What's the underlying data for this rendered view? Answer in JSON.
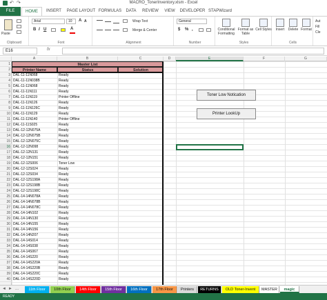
{
  "window": {
    "title": "MACRO_TonerInventory.xlsm - Excel"
  },
  "ribbon_tabs": [
    "FILE",
    "HOME",
    "INSERT",
    "PAGE LAYOUT",
    "FORMULAS",
    "DATA",
    "REVIEW",
    "VIEW",
    "DEVELOPER",
    "STAPWizard"
  ],
  "active_tab": "HOME",
  "ribbon": {
    "clipboard": {
      "paste": "Paste",
      "label": "Clipboard"
    },
    "font": {
      "name": "Arial",
      "size": "10",
      "bold": "B",
      "italic": "I",
      "underline": "U",
      "label": "Font"
    },
    "alignment": {
      "wrap_text": "Wrap Text",
      "merge_center": "Merge & Center",
      "label": "Alignment"
    },
    "number": {
      "format": "General",
      "currency": "$",
      "percent": "%",
      "comma": ",",
      "label": "Number"
    },
    "styles": {
      "conditional": "Conditional Formatting",
      "format_table": "Format as Table",
      "cell_styles": "Cell Styles",
      "label": "Styles"
    },
    "cells": {
      "insert": "Insert",
      "delete": "Delete",
      "format": "Format",
      "label": "Cells"
    },
    "editing": {
      "autosum": "Aut",
      "fill": "Fill",
      "clear": "Cle"
    }
  },
  "formula_bar": {
    "name_box": "E16",
    "fx": "fx",
    "value": ""
  },
  "columns": [
    "A",
    "B",
    "C",
    "D",
    "E",
    "F",
    "G"
  ],
  "selected_column": "E",
  "selected_row": "16",
  "rows": [
    "1",
    "2",
    "3",
    "4",
    "5",
    "6",
    "7",
    "8",
    "9",
    "10",
    "11",
    "12",
    "13",
    "14",
    "15",
    "16",
    "17",
    "18",
    "19",
    "20",
    "21",
    "22",
    "23",
    "24",
    "25",
    "26",
    "27",
    "28",
    "29",
    "30",
    "31",
    "32",
    "33",
    "34",
    "35",
    "36",
    "37",
    "38",
    "39",
    "40"
  ],
  "master_list": {
    "title": "Master List",
    "headers": [
      "Printer Name",
      "Status",
      "Solution"
    ],
    "entries": [
      {
        "name": "DAL-11-11N068",
        "status": "Ready"
      },
      {
        "name": "DAL-11-11N038B",
        "status": "Ready"
      },
      {
        "name": "DAL-11-11N068",
        "status": "Ready"
      },
      {
        "name": "DAL-11-11N111",
        "status": "Ready"
      },
      {
        "name": "DAL-11-11N119",
        "status": "Printer Offline"
      },
      {
        "name": "DAL-11-11N126",
        "status": "Ready"
      },
      {
        "name": "DAL-11-11N126C",
        "status": "Ready"
      },
      {
        "name": "DAL-11-11N129",
        "status": "Ready"
      },
      {
        "name": "DAL-11-11N140",
        "status": "Printer Offline"
      },
      {
        "name": "DAL-11-11S025",
        "status": "Ready"
      },
      {
        "name": "DAL-12-12N075A",
        "status": "Ready"
      },
      {
        "name": "DAL-12-12N075B",
        "status": "Ready"
      },
      {
        "name": "DAL-12-12N075C",
        "status": "Ready"
      },
      {
        "name": "DAL-12-12N098",
        "status": "Ready"
      },
      {
        "name": "DAL-12-12N131",
        "status": "Ready"
      },
      {
        "name": "DAL-12-12N151",
        "status": "Ready"
      },
      {
        "name": "DAL-12-12S006",
        "status": "Toner Low"
      },
      {
        "name": "DAL-12-12S024",
        "status": "Ready"
      },
      {
        "name": "DAL-12-12S034",
        "status": "Ready"
      },
      {
        "name": "DAL-12-12S198A",
        "status": "Ready"
      },
      {
        "name": "DAL-12-12S198B",
        "status": "Ready"
      },
      {
        "name": "DAL-12-12S198C",
        "status": "Ready"
      },
      {
        "name": "DAL-14-14N078A",
        "status": "Ready"
      },
      {
        "name": "DAL-14-14N078B",
        "status": "Ready"
      },
      {
        "name": "DAL-14-14N078C",
        "status": "Ready"
      },
      {
        "name": "DAL-14-14N102",
        "status": "Ready"
      },
      {
        "name": "DAL-14-14N130",
        "status": "Ready"
      },
      {
        "name": "DAL-14-14N155",
        "status": "Ready"
      },
      {
        "name": "DAL-14-14N156",
        "status": "Ready"
      },
      {
        "name": "DAL-14-14N207",
        "status": "Ready"
      },
      {
        "name": "DAL-14-14S014",
        "status": "Ready"
      },
      {
        "name": "DAL-14-14S038",
        "status": "Ready"
      },
      {
        "name": "DAL-14-14S067",
        "status": "Ready"
      },
      {
        "name": "DAL-14-14S220",
        "status": "Ready"
      },
      {
        "name": "DAL-14-14S220A",
        "status": "Ready"
      },
      {
        "name": "DAL-14-14S220B",
        "status": "Ready"
      },
      {
        "name": "DAL-14-14S220C",
        "status": "Ready"
      },
      {
        "name": "DAL-14-14S220D",
        "status": "Ready"
      }
    ]
  },
  "buttons": {
    "toner_low": "Toner Low Notication",
    "printer_lookup": "Printer LookUp"
  },
  "sheet_tabs": [
    {
      "label": "11th Floor",
      "color": "#00b0f0"
    },
    {
      "label": "10th Floor",
      "color": "#92d050"
    },
    {
      "label": "14th Floor",
      "color": "#ff0000"
    },
    {
      "label": "15th Floor",
      "color": "#7030a0"
    },
    {
      "label": "16th Floor",
      "color": "#0070c0"
    },
    {
      "label": "17th Floor",
      "color": "#f79646"
    },
    {
      "label": "Printers",
      "color": "#d9d9d9"
    },
    {
      "label": "RETURNS",
      "color": "#000000"
    },
    {
      "label": "OLD Toner-Invent",
      "color": "#ffff00"
    },
    {
      "label": "MASTER",
      "color": "#ffffff"
    },
    {
      "label": "magic",
      "color": "#ffffff"
    }
  ],
  "active_sheet": "magic",
  "sheet_nav": {
    "prev": "◄",
    "next": "►",
    "ellipsis": "..."
  },
  "status": "READY",
  "colors": {
    "excel_green": "#217346",
    "header_fill": "#d9999b"
  }
}
